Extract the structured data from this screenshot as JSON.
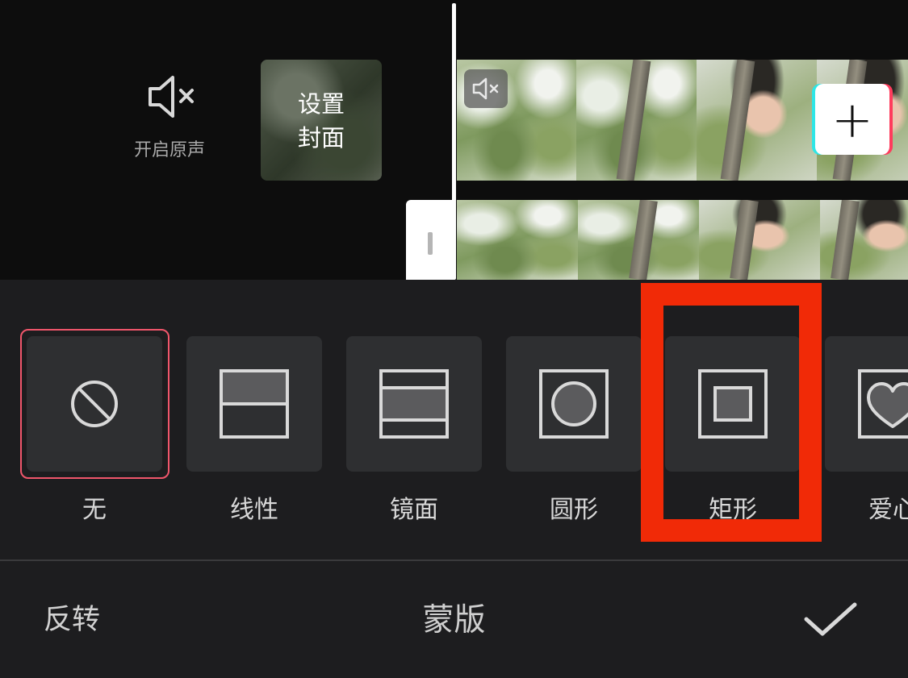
{
  "timeline": {
    "mute_label": "开启原声",
    "cover_label": "设置\n封面",
    "add_clip_symbol": "+"
  },
  "masks": [
    {
      "label": "无",
      "icon": "none-icon",
      "selected": true
    },
    {
      "label": "线性",
      "icon": "linear-mask-icon"
    },
    {
      "label": "镜面",
      "icon": "mirror-mask-icon"
    },
    {
      "label": "圆形",
      "icon": "circle-mask-icon"
    },
    {
      "label": "矩形",
      "icon": "rectangle-mask-icon",
      "highlighted": true
    },
    {
      "label": "爱心",
      "icon": "heart-mask-icon"
    }
  ],
  "bottom_bar": {
    "invert_label": "反转",
    "title": "蒙版"
  },
  "colors": {
    "selection_ring": "#f0566b",
    "highlight_box": "#f12a07",
    "panel_bg": "#1d1d1f",
    "tile_bg": "#2e2f31"
  }
}
